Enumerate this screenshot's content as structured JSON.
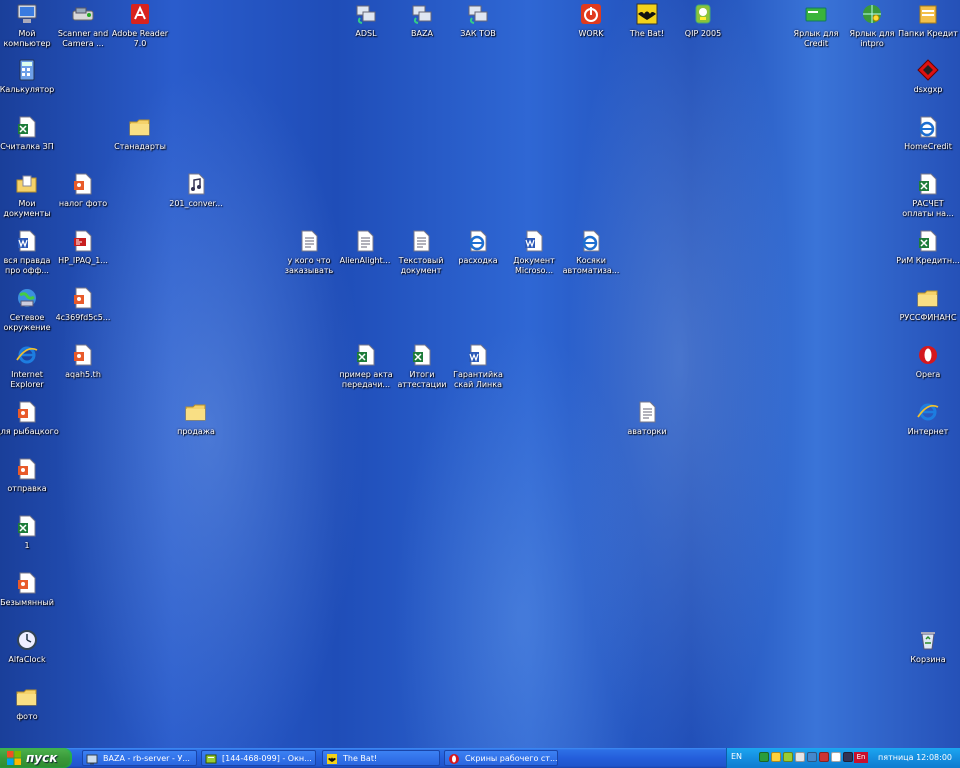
{
  "desktop": {
    "icons": [
      {
        "label": "Мой компьютер",
        "icon": "my-computer-icon"
      },
      {
        "label": "Scanner and Camera ...",
        "icon": "scanner-icon"
      },
      {
        "label": "Adobe Reader 7.0",
        "icon": "adobe-reader-icon"
      },
      {
        "label": "ADSL",
        "icon": "network-connection-icon"
      },
      {
        "label": "BAZA",
        "icon": "network-connection-icon"
      },
      {
        "label": "ЗАК ТОВ",
        "icon": "network-connection-icon"
      },
      {
        "label": "WORK",
        "icon": "power-icon"
      },
      {
        "label": "The Bat!",
        "icon": "the-bat-icon"
      },
      {
        "label": "QIP 2005",
        "icon": "qip-icon"
      },
      {
        "label": "Ярлык для Credit",
        "icon": "green-card-icon"
      },
      {
        "label": "Ярлык для intpro",
        "icon": "globe-key-icon"
      },
      {
        "label": "Папки Кредит",
        "icon": "folder-stack-icon"
      },
      {
        "label": "Калькулятор",
        "icon": "calculator-icon"
      },
      {
        "label": "dsxgxp",
        "icon": "red-diamond-icon"
      },
      {
        "label": "Считалка ЗП",
        "icon": "excel-doc-icon"
      },
      {
        "label": "Станадарты",
        "icon": "folder-icon"
      },
      {
        "label": "HomeCredit",
        "icon": "ie-doc-icon"
      },
      {
        "label": "Мои документы",
        "icon": "my-documents-icon"
      },
      {
        "label": "налог фото",
        "icon": "image-doc-icon"
      },
      {
        "label": "201_conver...",
        "icon": "mp3-icon"
      },
      {
        "label": "РАСЧЕТ оплаты на...",
        "icon": "excel-doc-icon"
      },
      {
        "label": "вся правда про офф...",
        "icon": "word-doc-icon"
      },
      {
        "label": "HP_IPAQ_1...",
        "icon": "pdf-icon"
      },
      {
        "label": "у кого что заказывать",
        "icon": "text-doc-icon"
      },
      {
        "label": "AlienAlight...",
        "icon": "text-doc-icon"
      },
      {
        "label": "Текстовый документ",
        "icon": "text-doc-icon"
      },
      {
        "label": "расходка",
        "icon": "ie-doc-icon"
      },
      {
        "label": "Документ Microso...",
        "icon": "word-doc-icon"
      },
      {
        "label": "Косяки автоматиза...",
        "icon": "ie-doc-icon"
      },
      {
        "label": "РиМ Кредитн...",
        "icon": "excel-doc-icon"
      },
      {
        "label": "Сетевое окружение",
        "icon": "network-places-icon"
      },
      {
        "label": "4c369fd5c5...",
        "icon": "image-doc-icon"
      },
      {
        "label": "РУССФИНАНС",
        "icon": "folder-icon"
      },
      {
        "label": "Internet Explorer",
        "icon": "internet-explorer-icon"
      },
      {
        "label": "aqah5.th",
        "icon": "image-doc-icon"
      },
      {
        "label": "пример акта передачи...",
        "icon": "excel-doc-icon"
      },
      {
        "label": "Итоги аттестации",
        "icon": "excel-doc-icon"
      },
      {
        "label": "Гарантийка скай Линка",
        "icon": "word-doc-icon"
      },
      {
        "label": "Opera",
        "icon": "opera-icon"
      },
      {
        "label": "для рыбацкого",
        "icon": "image-doc-icon"
      },
      {
        "label": "продажа",
        "icon": "folder-icon"
      },
      {
        "label": "аваторки",
        "icon": "text-doc-icon"
      },
      {
        "label": "Интернет",
        "icon": "internet-explorer-icon"
      },
      {
        "label": "отправка",
        "icon": "image-doc-icon"
      },
      {
        "label": "1",
        "icon": "excel-doc-icon"
      },
      {
        "label": "Безымянный",
        "icon": "image-doc-icon"
      },
      {
        "label": "AlfaClock",
        "icon": "clock-icon"
      },
      {
        "label": "Корзина",
        "icon": "recycle-bin-icon"
      },
      {
        "label": "фото",
        "icon": "folder-icon"
      }
    ]
  },
  "taskbar": {
    "start_label": "пуск",
    "tasks": [
      {
        "label": "BAZA - rb-server - У...",
        "icon": "remote-desktop-icon"
      },
      {
        "label": "[144-468-099] - Окн...",
        "icon": "chat-window-icon"
      },
      {
        "label": "The Bat!",
        "icon": "the-bat-icon"
      },
      {
        "label": "Скрины рабочего ст...",
        "icon": "opera-icon"
      }
    ],
    "tray": {
      "language": "EN",
      "language_indicator": "En",
      "clock": "пятница 12:08:00",
      "icons": [
        "antivirus-icon",
        "network-icon",
        "qip-tray-icon",
        "speaker-icon",
        "tools-icon",
        "update-icon",
        "monitor-icon",
        "keyboard-icon"
      ]
    }
  },
  "colors": {
    "desktop_blue": "#2a5ccc",
    "taskbar_blue": "#245edb",
    "start_green": "#3a9a3a",
    "tray_blue": "#158ee0"
  }
}
